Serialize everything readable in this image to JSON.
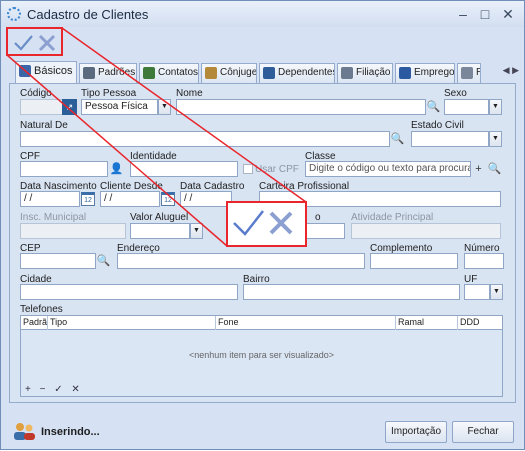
{
  "window": {
    "title": "Cadastro de Clientes"
  },
  "titlebar": {
    "minimize": "–",
    "maximize": "□",
    "close": "✕"
  },
  "tabs": [
    {
      "label": "Básicos",
      "color": "#3b66a8"
    },
    {
      "label": "Padrões",
      "color": "#5a6b80"
    },
    {
      "label": "Contatos",
      "color": "#3f7a3a"
    },
    {
      "label": "Cônjuge",
      "color": "#b48a3a"
    },
    {
      "label": "Dependentes",
      "color": "#2f5d99"
    },
    {
      "label": "Filiação",
      "color": "#6b7a8f"
    },
    {
      "label": "Emprego",
      "color": "#2c5aa0"
    },
    {
      "label": "R",
      "color": "#7a869a"
    }
  ],
  "tab_arrows": "◀ ▶",
  "form": {
    "codigo_label": "Código",
    "tipo_pessoa_label": "Tipo Pessoa",
    "tipo_pessoa_value": "Pessoa Física",
    "nome_label": "Nome",
    "sexo_label": "Sexo",
    "natural_de_label": "Natural De",
    "estado_civil_label": "Estado Civil",
    "cpf_label": "CPF",
    "identidade_label": "Identidade",
    "usar_cpf_label": "Usar CPF",
    "classe_label": "Classe",
    "classe_placeholder": "Digite o código ou texto para procura",
    "data_nascimento_label": "Data Nascimento",
    "data_nascimento_value": " / /",
    "cliente_desde_label": "Cliente Desde",
    "cliente_desde_value": " / /",
    "data_cadastro_label": "Data Cadastro",
    "data_cadastro_value": " / /",
    "carteira_label": "Carteira Profissional",
    "insc_municipal_label": "Insc. Municipal",
    "valor_aluguel_label": "Valor Aluguel",
    "partial_label": "o",
    "atividade_label": "Atividade Principal",
    "cep_label": "CEP",
    "endereco_label": "Endereço",
    "complemento_label": "Complemento",
    "numero_label": "Número",
    "cidade_label": "Cidade",
    "bairro_label": "Bairro",
    "uf_label": "UF",
    "telefones_label": "Telefones"
  },
  "grid": {
    "columns": [
      "Padrã",
      "Tipo",
      "Fone",
      "Ramal",
      "DDD"
    ],
    "empty_text": "<nenhum item para ser visualizado>",
    "footer": "+ − ✓ ✕"
  },
  "footer": {
    "status": "Inserindo...",
    "importacao": "Importação",
    "fechar": "Fechar"
  },
  "colors": {
    "annotation": "#e8262c",
    "accent": "#3b66a8"
  },
  "icons": [
    "check-icon",
    "close-x-icon",
    "search-icon",
    "calendar-icon",
    "user-icon",
    "users-icon"
  ]
}
